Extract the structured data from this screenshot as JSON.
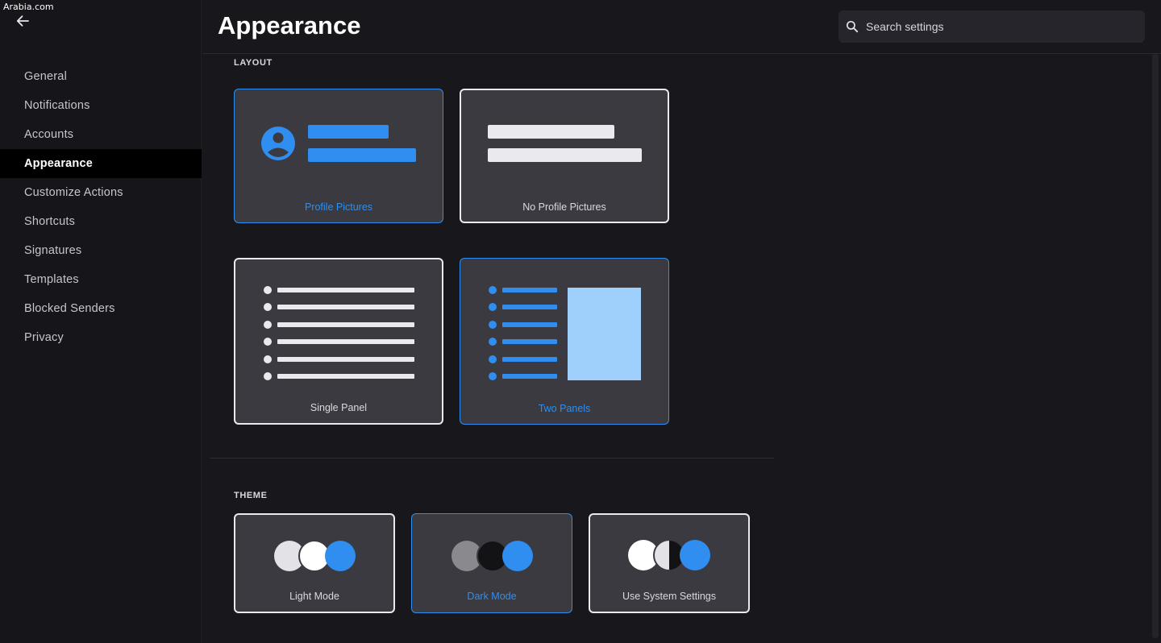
{
  "watermark": "Arabia.com",
  "header": {
    "title": "Appearance",
    "search_placeholder": "Search settings"
  },
  "sidebar": {
    "items": [
      {
        "label": "General",
        "active": false
      },
      {
        "label": "Notifications",
        "active": false
      },
      {
        "label": "Accounts",
        "active": false
      },
      {
        "label": "Appearance",
        "active": true
      },
      {
        "label": "Customize Actions",
        "active": false
      },
      {
        "label": "Shortcuts",
        "active": false
      },
      {
        "label": "Signatures",
        "active": false
      },
      {
        "label": "Templates",
        "active": false
      },
      {
        "label": "Blocked Senders",
        "active": false
      },
      {
        "label": "Privacy",
        "active": false
      }
    ]
  },
  "layout": {
    "title": "LAYOUT",
    "options": [
      {
        "label": "Profile Pictures",
        "selected": true
      },
      {
        "label": "No Profile Pictures",
        "selected": false
      },
      {
        "label": "Single Panel",
        "selected": false
      },
      {
        "label": "Two Panels",
        "selected": true
      }
    ]
  },
  "theme": {
    "title": "THEME",
    "options": [
      {
        "label": "Light Mode",
        "selected": false
      },
      {
        "label": "Dark Mode",
        "selected": true
      },
      {
        "label": "Use System Settings",
        "selected": false
      }
    ]
  },
  "colors": {
    "accent": "#2f8ef0",
    "accent_light": "#9fd0fb",
    "card_bg": "#3a3a40",
    "page_bg": "#17171c",
    "sidebar_active_bg": "#000000"
  },
  "icons": {
    "back": "arrow-left-icon",
    "search": "magnifier-icon"
  }
}
